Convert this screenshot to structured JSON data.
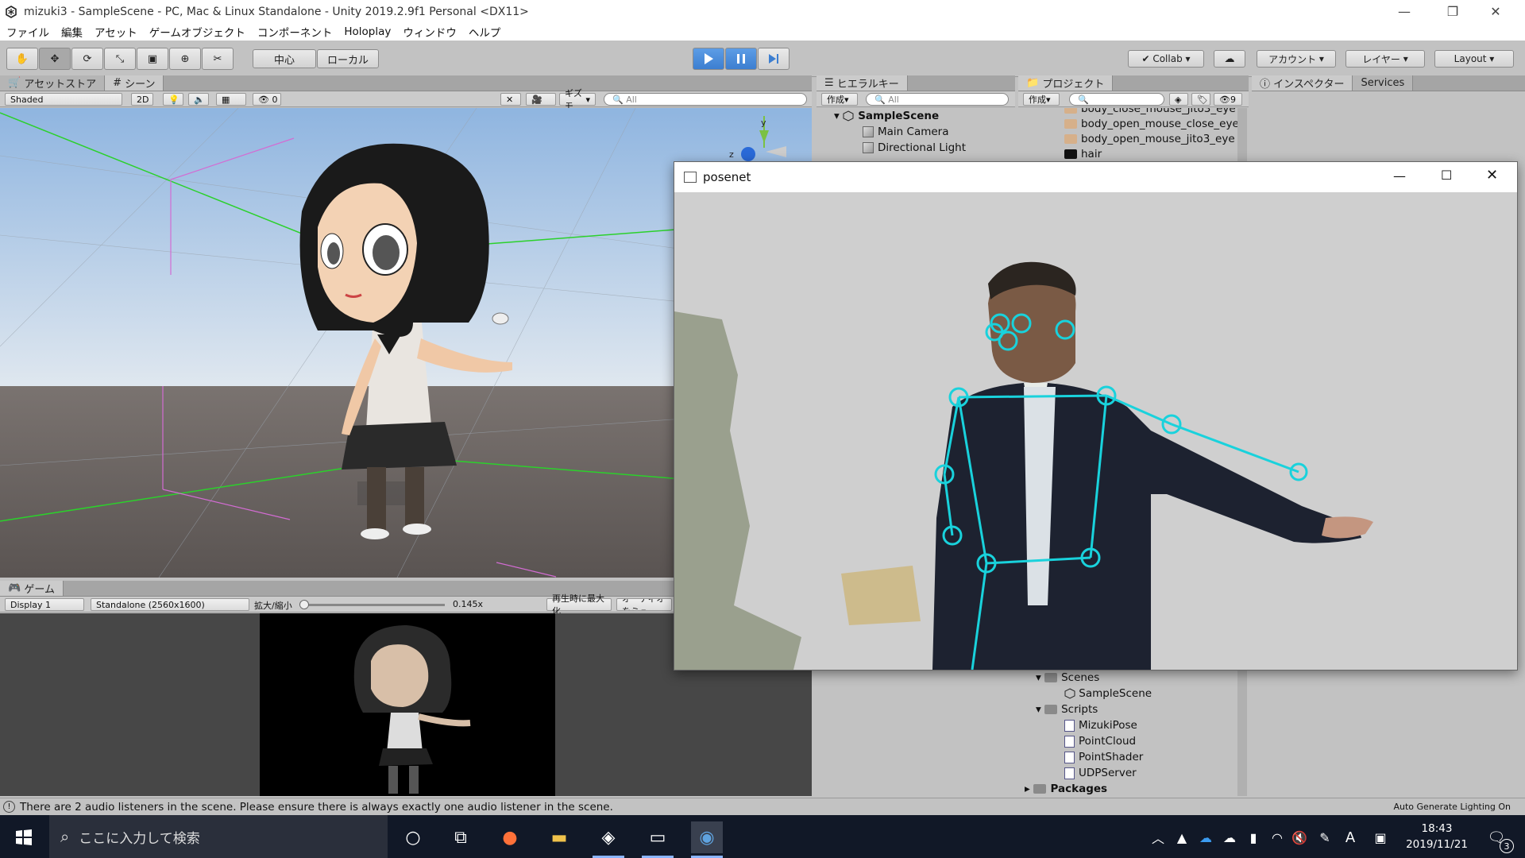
{
  "window": {
    "title": "mizuki3 - SampleScene - PC, Mac & Linux Standalone - Unity 2019.2.9f1 Personal <DX11>"
  },
  "menu": [
    "ファイル",
    "編集",
    "アセット",
    "ゲームオブジェクト",
    "コンポーネント",
    "Holoplay",
    "ウィンドウ",
    "ヘルプ"
  ],
  "toolbar": {
    "pivot": "中心",
    "space": "ローカル",
    "collab": "Collab",
    "account": "アカウント",
    "layers": "レイヤー",
    "layout": "Layout"
  },
  "scene_panel": {
    "tabs": [
      "アセットストア",
      "シーン"
    ],
    "shading": "Shaded",
    "mode_2d": "2D",
    "fx_count": "0",
    "gizmos": "ギズモ",
    "search_placeholder": "All"
  },
  "game_panel": {
    "tab": "ゲーム",
    "display": "Display 1",
    "resolution": "Standalone (2560x1600)",
    "scale_label": "拡大/縮小",
    "scale_value": "0.145x",
    "maximize": "再生時に最大化",
    "audio": "オーディオをミュ"
  },
  "hierarchy": {
    "tab": "ヒエラルキー",
    "create": "作成",
    "search_placeholder": "All",
    "scene": "SampleScene",
    "items": [
      "Main Camera",
      "Directional Light"
    ]
  },
  "project": {
    "tab": "プロジェクト",
    "create": "作成",
    "hidden_count": "9",
    "top_items": [
      "body_close_mouse_jito3_eye",
      "body_open_mouse_close_eye",
      "body_open_mouse_jito3_eye",
      "hair"
    ],
    "folders": {
      "scenes": "Scenes",
      "scene_file": "SampleScene",
      "scripts": "Scripts",
      "script_files": [
        "MizukiPose",
        "PointCloud",
        "PointShader",
        "UDPServer"
      ],
      "packages": "Packages"
    }
  },
  "inspector": {
    "tab": "インスペクター",
    "services": "Services"
  },
  "posenet": {
    "title": "posenet"
  },
  "status": {
    "message": "There are 2 audio listeners in the scene. Please ensure there is always exactly one audio listener in the scene.",
    "lighting": "Auto Generate Lighting On"
  },
  "taskbar": {
    "search_placeholder": "ここに入力して検索",
    "time": "18:43",
    "date": "2019/11/21",
    "notification_count": "3",
    "ime": "A"
  }
}
